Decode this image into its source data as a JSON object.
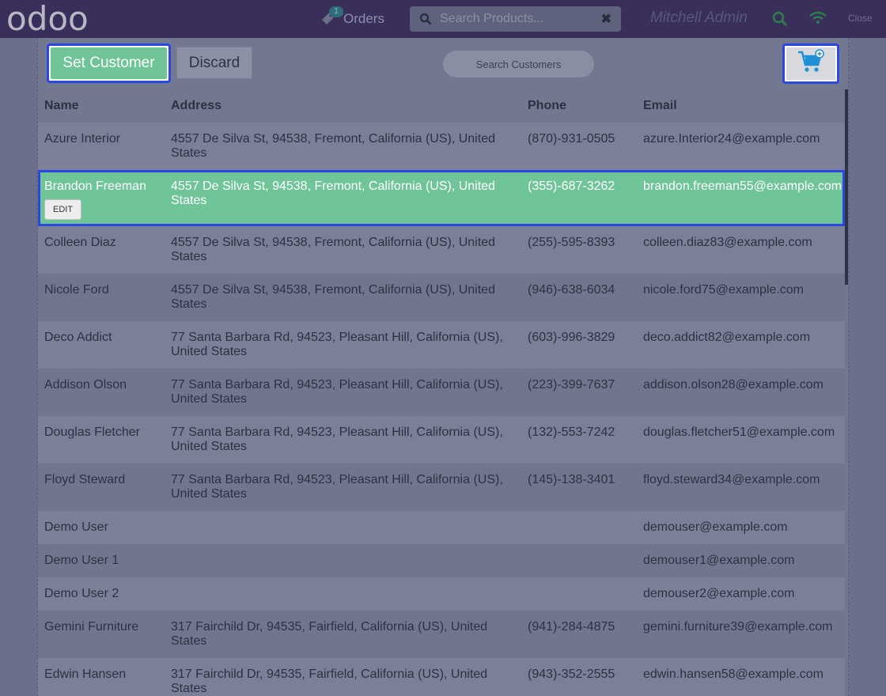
{
  "header": {
    "logo_text": "odoo",
    "orders_label": "Orders",
    "orders_badge": "1",
    "product_search_placeholder": "Search Products...",
    "user_name": "Mitchell Admin",
    "close_label": "Close"
  },
  "toolbar": {
    "set_customer_label": "Set Customer",
    "discard_label": "Discard",
    "customer_search_placeholder": "Search Customers"
  },
  "table": {
    "columns": {
      "name": "Name",
      "address": "Address",
      "phone": "Phone",
      "email": "Email"
    },
    "edit_label": "EDIT",
    "rows": [
      {
        "name": "Azure Interior",
        "address": "4557 De Silva St, 94538, Fremont, California (US), United States",
        "phone": "(870)-931-0505",
        "email": "azure.Interior24@example.com"
      },
      {
        "name": "Brandon Freeman",
        "address": "4557 De Silva St, 94538, Fremont, California (US), United States",
        "phone": "(355)-687-3262",
        "email": "brandon.freeman55@example.com"
      },
      {
        "name": "Colleen Diaz",
        "address": "4557 De Silva St, 94538, Fremont, California (US), United States",
        "phone": "(255)-595-8393",
        "email": "colleen.diaz83@example.com"
      },
      {
        "name": "Nicole Ford",
        "address": "4557 De Silva St, 94538, Fremont, California (US), United States",
        "phone": "(946)-638-6034",
        "email": "nicole.ford75@example.com"
      },
      {
        "name": "Deco Addict",
        "address": "77 Santa Barbara Rd, 94523, Pleasant Hill, California (US), United States",
        "phone": "(603)-996-3829",
        "email": "deco.addict82@example.com"
      },
      {
        "name": "Addison Olson",
        "address": "77 Santa Barbara Rd, 94523, Pleasant Hill, California (US), United States",
        "phone": "(223)-399-7637",
        "email": "addison.olson28@example.com"
      },
      {
        "name": "Douglas Fletcher",
        "address": "77 Santa Barbara Rd, 94523, Pleasant Hill, California (US), United States",
        "phone": "(132)-553-7242",
        "email": "douglas.fletcher51@example.com"
      },
      {
        "name": "Floyd Steward",
        "address": "77 Santa Barbara Rd, 94523, Pleasant Hill, California (US), United States",
        "phone": "(145)-138-3401",
        "email": "floyd.steward34@example.com"
      },
      {
        "name": "Demo User",
        "address": "",
        "phone": "",
        "email": "demouser@example.com"
      },
      {
        "name": "Demo User 1",
        "address": "",
        "phone": "",
        "email": "demouser1@example.com"
      },
      {
        "name": "Demo User 2",
        "address": "",
        "phone": "",
        "email": "demouser2@example.com"
      },
      {
        "name": "Gemini Furniture",
        "address": "317 Fairchild Dr, 94535, Fairfield, California (US), United States",
        "phone": "(941)-284-4875",
        "email": "gemini.furniture39@example.com"
      },
      {
        "name": "Edwin Hansen",
        "address": "317 Fairchild Dr, 94535, Fairfield, California (US), United States",
        "phone": "(943)-352-2555",
        "email": "edwin.hansen58@example.com"
      }
    ]
  },
  "colors": {
    "topbar": "#3a2f5a",
    "accent_green": "#6fc598",
    "focus_blue": "#2b48e0"
  }
}
